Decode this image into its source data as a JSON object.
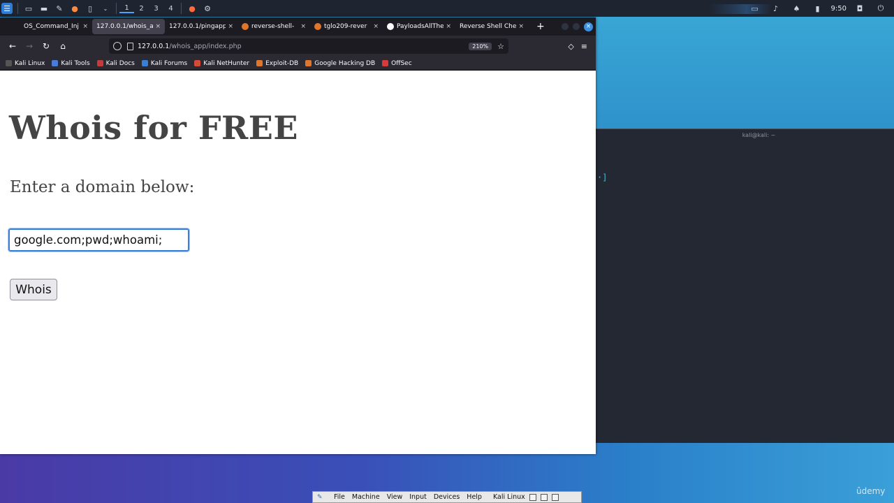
{
  "top_panel": {
    "workspaces": [
      "1",
      "2",
      "3",
      "4"
    ],
    "clock": "9:50"
  },
  "terminal": {
    "title": "kali@kali: ~",
    "prompt_fragment": "·]"
  },
  "browser": {
    "tabs": [
      {
        "label": "OS_Command_Inj",
        "icon": "page-icon",
        "active": false
      },
      {
        "label": "127.0.0.1/whois_a",
        "icon": "page-icon",
        "active": true
      },
      {
        "label": "127.0.0.1/pingapp",
        "icon": "page-icon",
        "active": false
      },
      {
        "label": "reverse-shell-",
        "icon": "flame-icon",
        "active": false
      },
      {
        "label": "tglo209-rever",
        "icon": "flame-icon",
        "active": false
      },
      {
        "label": "PayloadsAllThe",
        "icon": "github-icon",
        "active": false
      },
      {
        "label": "Reverse Shell Che",
        "icon": "page-icon",
        "active": false
      }
    ],
    "url": {
      "host": "127.0.0.1",
      "path": "/whois_app/index.php"
    },
    "zoom": "210%",
    "bookmarks": [
      {
        "label": "Kali Linux",
        "color": "#2b2b2b"
      },
      {
        "label": "Kali Tools",
        "color": "#4a7bd6"
      },
      {
        "label": "Kali Docs",
        "color": "#c43b3b"
      },
      {
        "label": "Kali Forums",
        "color": "#3a7fd6"
      },
      {
        "label": "Kali NetHunter",
        "color": "#d64a3a"
      },
      {
        "label": "Exploit-DB",
        "color": "#e0762a"
      },
      {
        "label": "Google Hacking DB",
        "color": "#e0762a"
      },
      {
        "label": "OffSec",
        "color": "#d63a3a"
      }
    ]
  },
  "page": {
    "heading": "Whois for FREE",
    "subheading": "Enter a domain below:",
    "input_value": "google.com;pwd;whoami;",
    "button_label": "Whois"
  },
  "vbox": {
    "menu": [
      "File",
      "Machine",
      "View",
      "Input",
      "Devices",
      "Help"
    ],
    "title": "Kali Linux"
  },
  "watermark": "ûdemy"
}
